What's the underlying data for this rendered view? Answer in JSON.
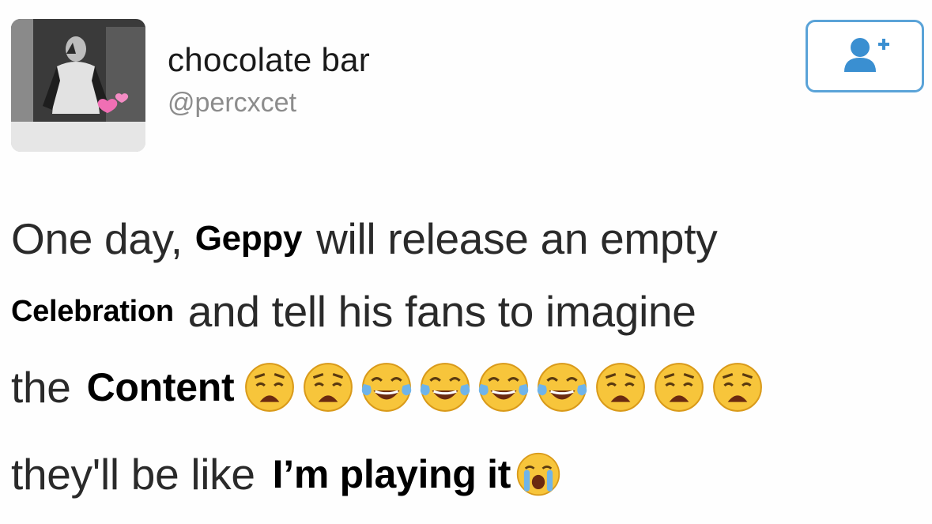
{
  "profile": {
    "display_name": "chocolate bar",
    "handle": "@percxcet"
  },
  "follow_button": {
    "icon": "add-user-icon",
    "color": "#5aa3d8"
  },
  "tweet": {
    "line1": {
      "pre": "One day,",
      "bold": "Geppy",
      "post": "will release an empty"
    },
    "line2": {
      "bold": "Celebration",
      "post": "and tell his fans to imagine"
    },
    "line3": {
      "pre": "the",
      "bold": "Content",
      "emojis": [
        "weary-face",
        "weary-face",
        "tears-of-joy",
        "tears-of-joy",
        "tears-of-joy",
        "tears-of-joy",
        "weary-face",
        "weary-face",
        "weary-face"
      ]
    },
    "line4": {
      "pre": "they'll be like",
      "bold": "I’m playing it",
      "emoji": "loudly-crying-face"
    }
  }
}
